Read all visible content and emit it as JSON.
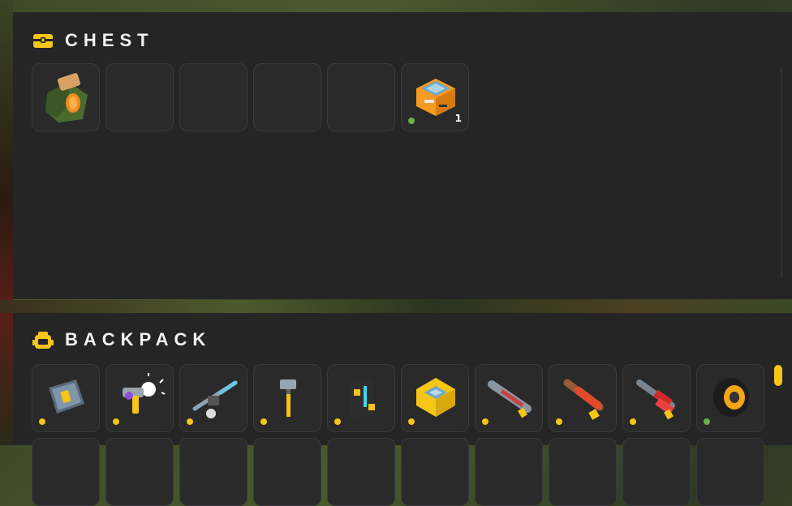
{
  "chest": {
    "title": "CHEST",
    "icon": "chest-icon",
    "slots": [
      {
        "item": "supply-bag-icon",
        "filled": true
      },
      {
        "filled": false
      },
      {
        "filled": false
      },
      {
        "filled": false
      },
      {
        "filled": false
      },
      {
        "item": "supply-crate-icon",
        "filled": true,
        "rarity_color": "#6ab04c",
        "count": "1"
      }
    ]
  },
  "backpack": {
    "title": "BACKPACK",
    "icon": "backpack-icon",
    "slots": [
      {
        "item": "plating-icon",
        "rarity_color": "#f5c518"
      },
      {
        "item": "spark-blaster-icon",
        "rarity_color": "#f5c518"
      },
      {
        "item": "turret-mount-icon",
        "rarity_color": "#f5c518"
      },
      {
        "item": "hammer-icon",
        "rarity_color": "#f5c518"
      },
      {
        "item": "power-core-icon",
        "rarity_color": "#f5c518"
      },
      {
        "item": "chip-module-icon",
        "rarity_color": "#f5c518"
      },
      {
        "item": "rocket-launcher-icon",
        "rarity_color": "#f5c518"
      },
      {
        "item": "flamethrower-icon",
        "rarity_color": "#f5c518"
      },
      {
        "item": "dynamite-gun-icon",
        "rarity_color": "#f5c518"
      },
      {
        "item": "wheel-icon",
        "rarity_color": "#6ab04c"
      }
    ]
  },
  "colors": {
    "accent": "#f5c518",
    "uncommon": "#6ab04c",
    "panel": "#252526",
    "slot_border": "#3a3a3c"
  }
}
